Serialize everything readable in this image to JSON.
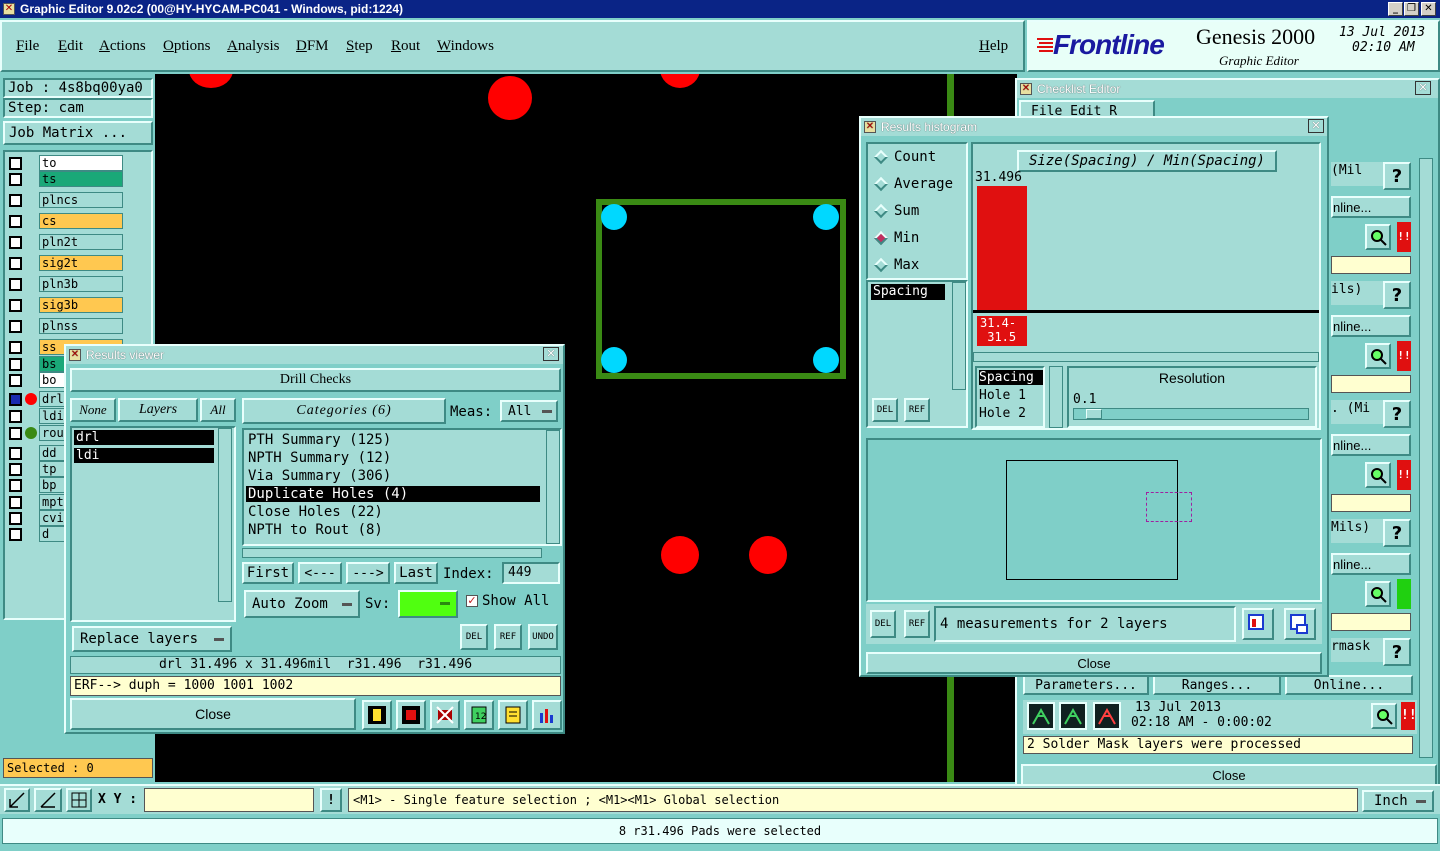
{
  "window": {
    "title": "Graphic Editor 9.02c2 (00@HY-HYCAM-PC041 - Windows, pid:1224)"
  },
  "menubar": {
    "items": [
      "File",
      "Edit",
      "Actions",
      "Options",
      "Analysis",
      "DFM",
      "Step",
      "Rout",
      "Windows"
    ],
    "help": "Help"
  },
  "brand": {
    "logo": "Frontline",
    "product": "Genesis 2000",
    "subtitle": "Graphic Editor",
    "date": "13 Jul 2013",
    "time": "02:10 AM"
  },
  "job": {
    "job_label": "Job : 4s8bq00ya0",
    "step_label": "Step: cam",
    "matrix_button": "Job Matrix ..."
  },
  "layers": [
    {
      "name": "to",
      "color": "#ffffff"
    },
    {
      "name": "ts",
      "color": "#1aa878"
    },
    {
      "name": "plncs",
      "color": "#a4dcd6"
    },
    {
      "name": "cs",
      "color": "#ffc850"
    },
    {
      "name": "pln2t",
      "color": "#a4dcd6"
    },
    {
      "name": "sig2t",
      "color": "#ffc850"
    },
    {
      "name": "pln3b",
      "color": "#a4dcd6"
    },
    {
      "name": "sig3b",
      "color": "#ffc850"
    },
    {
      "name": "plnss",
      "color": "#a4dcd6"
    },
    {
      "name": "ss",
      "color": "#ffc850"
    },
    {
      "name": "bs",
      "color": "#1aa878"
    },
    {
      "name": "bo",
      "color": "#ffffff"
    },
    {
      "name": "drl",
      "color": "#a4dcd6"
    },
    {
      "name": "ldi",
      "color": "#a4dcd6"
    },
    {
      "name": "rou",
      "color": "#a4dcd6"
    },
    {
      "name": "dd",
      "color": "#a4dcd6"
    },
    {
      "name": "tp",
      "color": "#a4dcd6"
    },
    {
      "name": "bp",
      "color": "#a4dcd6"
    },
    {
      "name": "mpt",
      "color": "#a4dcd6"
    },
    {
      "name": "cvi",
      "color": "#a4dcd6"
    },
    {
      "name": "d",
      "color": "#a4dcd6"
    }
  ],
  "status": {
    "selected": "Selected : 0",
    "xy_label": "X Y :",
    "hint": "<M1> - Single feature selection ; <M1><M1> Global selection",
    "units": "Inch",
    "message": "8 r31.496 Pads were selected"
  },
  "results_viewer": {
    "title": "Results viewer",
    "header": "Drill Checks",
    "none_btn": "None",
    "layers_btn": "Layers",
    "all_btn": "All",
    "layer_list": [
      "drl",
      "ldi"
    ],
    "categories_btn": "Categories (6)",
    "meas_label": "Meas:",
    "meas_value": "All",
    "categories": [
      "PTH Summary (125)",
      "NPTH Summary (12)",
      "Via Summary (306)",
      "Duplicate Holes (4)",
      "Close Holes (22)",
      "NPTH to Rout (8)"
    ],
    "selected_category": "Duplicate Holes (4)",
    "first": "First",
    "prev": "<---",
    "next": "--->",
    "last": "Last",
    "index_label": "Index:",
    "index_value": "449",
    "auto_zoom": "Auto Zoom",
    "sv_label": "Sv:",
    "show_all": "Show All",
    "replace_layers": "Replace layers",
    "del": "DEL",
    "ref": "REF",
    "undo": "UNDO",
    "info": "drl 31.496 x 31.496mil  r31.496  r31.496",
    "erf": "ERF--> duph = 1000 1001 1002",
    "close": "Close"
  },
  "histogram": {
    "title": "Results histogram",
    "modes": [
      "Count",
      "Average",
      "Sum",
      "Min",
      "Max"
    ],
    "selected_mode": "Min",
    "list": [
      "Spacing"
    ],
    "chart_title": "Size(Spacing) / Min(Spacing)",
    "bar_value": "31.496",
    "bar_range": "31.4-\n 31.5",
    "measures": [
      "Spacing",
      "Hole 1",
      "Hole 2"
    ],
    "resolution_label": "Resolution",
    "resolution_value": "0.1",
    "del": "DEL",
    "ref": "REF",
    "measurements": "4 measurements for 2 layers",
    "close": "Close"
  },
  "checklist": {
    "title": "Checklist Editor",
    "menu": "File  Edit  R",
    "rows": [
      {
        "unit": "(Mil",
        "online": "nline..."
      },
      {
        "unit": "ils)",
        "online": "nline..."
      },
      {
        "unit": ". (Mi",
        "online": "nline..."
      },
      {
        "unit": "Mils)",
        "online": "nline..."
      },
      {
        "unit": "rmask",
        "online": ""
      }
    ],
    "params": "Parameters...",
    "ranges": "Ranges...",
    "online": "Online...",
    "date": "13 Jul 2013",
    "time": "02:18 AM - 0:00:02",
    "message": "2 Solder Mask layers were processed",
    "close": "Close"
  }
}
